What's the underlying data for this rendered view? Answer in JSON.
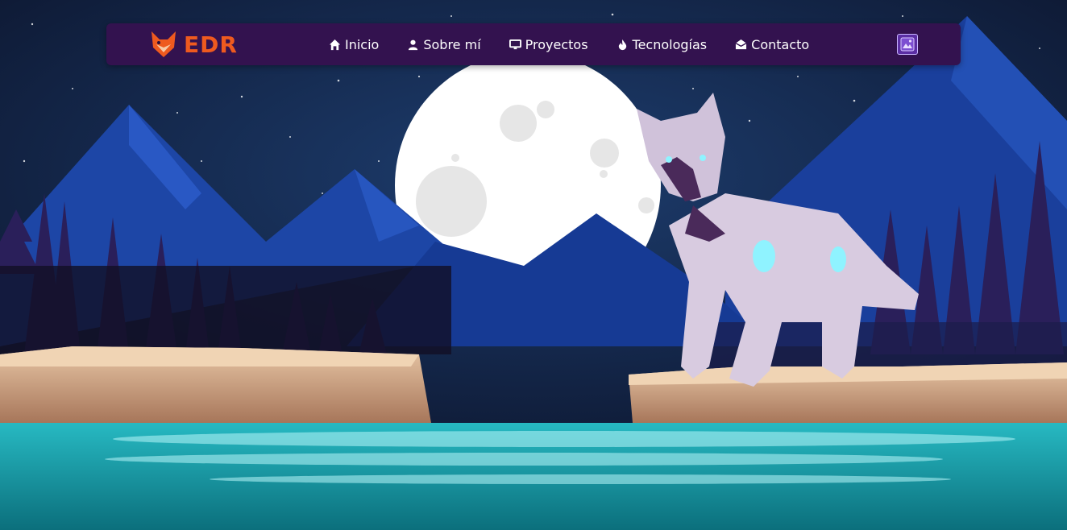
{
  "brand": {
    "name": "EDR",
    "logo_icon": "fox-icon"
  },
  "nav": {
    "items": [
      {
        "label": "Inicio",
        "icon": "home-icon"
      },
      {
        "label": "Sobre mí",
        "icon": "user-icon"
      },
      {
        "label": "Proyectos",
        "icon": "monitor-icon"
      },
      {
        "label": "Tecnologías",
        "icon": "fire-icon"
      },
      {
        "label": "Contacto",
        "icon": "envelope-icon"
      }
    ],
    "theme_toggle_icon": "image-theme-icon"
  },
  "hero": {
    "illustration": "robot-wolf-night-landscape",
    "colors": {
      "sky": "#0d1b3a",
      "mountain": "#1d46a6",
      "water": "#16a0a8",
      "nav_bg": "#33124f",
      "brand": "#ee5a1f"
    }
  }
}
